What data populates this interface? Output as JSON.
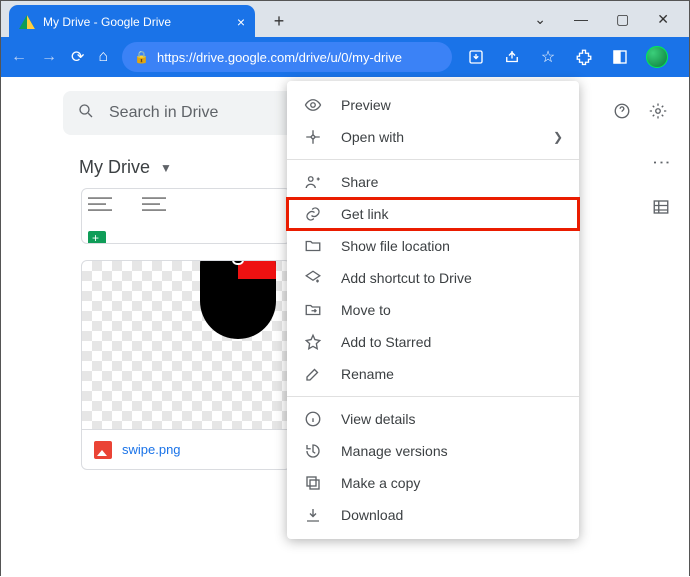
{
  "window": {
    "tab_title": "My Drive - Google Drive",
    "url": "https://drive.google.com/drive/u/0/my-drive"
  },
  "search": {
    "placeholder": "Search in Drive"
  },
  "breadcrumb": {
    "label": "My Drive"
  },
  "files": {
    "swipe": {
      "name": "swipe.png"
    }
  },
  "menu": {
    "preview": "Preview",
    "open_with": "Open with",
    "share": "Share",
    "get_link": "Get link",
    "show_location": "Show file location",
    "add_shortcut": "Add shortcut to Drive",
    "move_to": "Move to",
    "add_starred": "Add to Starred",
    "rename": "Rename",
    "view_details": "View details",
    "manage_versions": "Manage versions",
    "make_copy": "Make a copy",
    "download": "Download"
  }
}
